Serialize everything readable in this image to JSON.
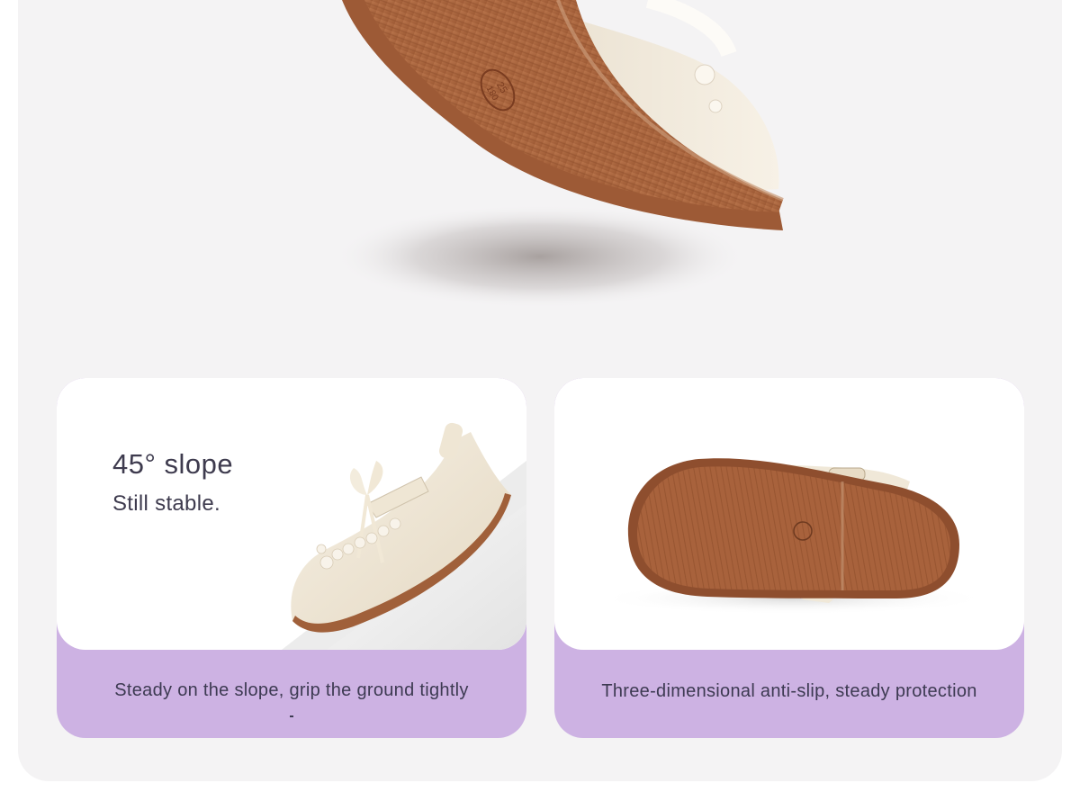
{
  "cards": {
    "slope": {
      "title": "45° slope",
      "subtitle": "Still stable.",
      "caption": "Steady on the slope, grip the ground tightly"
    },
    "sole": {
      "caption": "Three-dimensional anti-slip, steady protection"
    }
  },
  "sole_stamp": {
    "line1": "25",
    "line2": "180"
  },
  "colors": {
    "panel_bg": "#f4f3f4",
    "card_footer": "#cdb2e3",
    "sole_brown": "#a8623c",
    "shoe_cream": "#f2eadb",
    "text_dark": "#3d3a52"
  }
}
